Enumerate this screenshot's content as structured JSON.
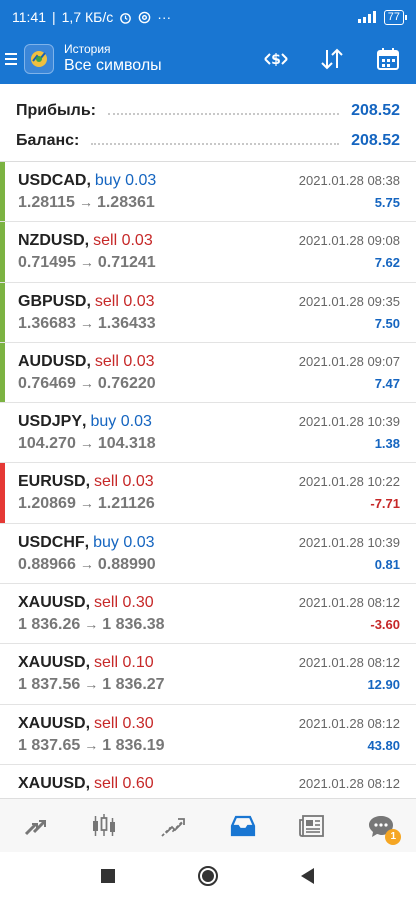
{
  "status_bar": {
    "time": "11:41",
    "network_speed": "1,7 КБ/с",
    "battery": "77"
  },
  "app_bar": {
    "subtitle": "История",
    "title": "Все символы"
  },
  "summary": {
    "profit_label": "Прибыль:",
    "profit_value": "208.52",
    "balance_label": "Баланс:",
    "balance_value": "208.52"
  },
  "trades": [
    {
      "symbol": "USDCAD",
      "side": "buy",
      "volume": "buy 0.03",
      "time": "2021.01.28 08:38",
      "open": "1.28115",
      "close": "1.28361",
      "profit": "5.75",
      "bar_color": "#7cb342"
    },
    {
      "symbol": "NZDUSD",
      "side": "sell",
      "volume": "sell 0.03",
      "time": "2021.01.28 09:08",
      "open": "0.71495",
      "close": "0.71241",
      "profit": "7.62",
      "bar_color": "#7cb342"
    },
    {
      "symbol": "GBPUSD",
      "side": "sell",
      "volume": "sell 0.03",
      "time": "2021.01.28 09:35",
      "open": "1.36683",
      "close": "1.36433",
      "profit": "7.50",
      "bar_color": "#7cb342"
    },
    {
      "symbol": "AUDUSD",
      "side": "sell",
      "volume": "sell 0.03",
      "time": "2021.01.28 09:07",
      "open": "0.76469",
      "close": "0.76220",
      "profit": "7.47",
      "bar_color": "#7cb342"
    },
    {
      "symbol": "USDJPY",
      "side": "buy",
      "volume": "buy 0.03",
      "time": "2021.01.28 10:39",
      "open": "104.270",
      "close": "104.318",
      "profit": "1.38",
      "bar_color": ""
    },
    {
      "symbol": "EURUSD",
      "side": "sell",
      "volume": "sell 0.03",
      "time": "2021.01.28 10:22",
      "open": "1.20869",
      "close": "1.21126",
      "profit": "-7.71",
      "bar_color": "#e53935"
    },
    {
      "symbol": "USDCHF",
      "side": "buy",
      "volume": "buy 0.03",
      "time": "2021.01.28 10:39",
      "open": "0.88966",
      "close": "0.88990",
      "profit": "0.81",
      "bar_color": ""
    },
    {
      "symbol": "XAUUSD",
      "side": "sell",
      "volume": "sell 0.30",
      "time": "2021.01.28 08:12",
      "open": "1 836.26",
      "close": "1 836.38",
      "profit": "-3.60",
      "bar_color": ""
    },
    {
      "symbol": "XAUUSD",
      "side": "sell",
      "volume": "sell 0.10",
      "time": "2021.01.28 08:12",
      "open": "1 837.56",
      "close": "1 836.27",
      "profit": "12.90",
      "bar_color": ""
    },
    {
      "symbol": "XAUUSD",
      "side": "sell",
      "volume": "sell 0.30",
      "time": "2021.01.28 08:12",
      "open": "1 837.65",
      "close": "1 836.19",
      "profit": "43.80",
      "bar_color": ""
    },
    {
      "symbol": "XAUUSD",
      "side": "sell",
      "volume": "sell 0.60",
      "time": "2021.01.28 08:12",
      "open": "",
      "close": "",
      "profit": "",
      "bar_color": ""
    }
  ],
  "bottom_nav": {
    "items": [
      "quotes-icon",
      "chart-icon",
      "trade-icon",
      "history-icon",
      "news-icon",
      "chat-icon"
    ],
    "active": "history-icon",
    "chat_badge": "1"
  },
  "colors": {
    "accent": "#1976d2",
    "buy": "#1565c0",
    "sell": "#c62828",
    "profit_positive": "#1565c0",
    "profit_negative": "#c62828"
  }
}
